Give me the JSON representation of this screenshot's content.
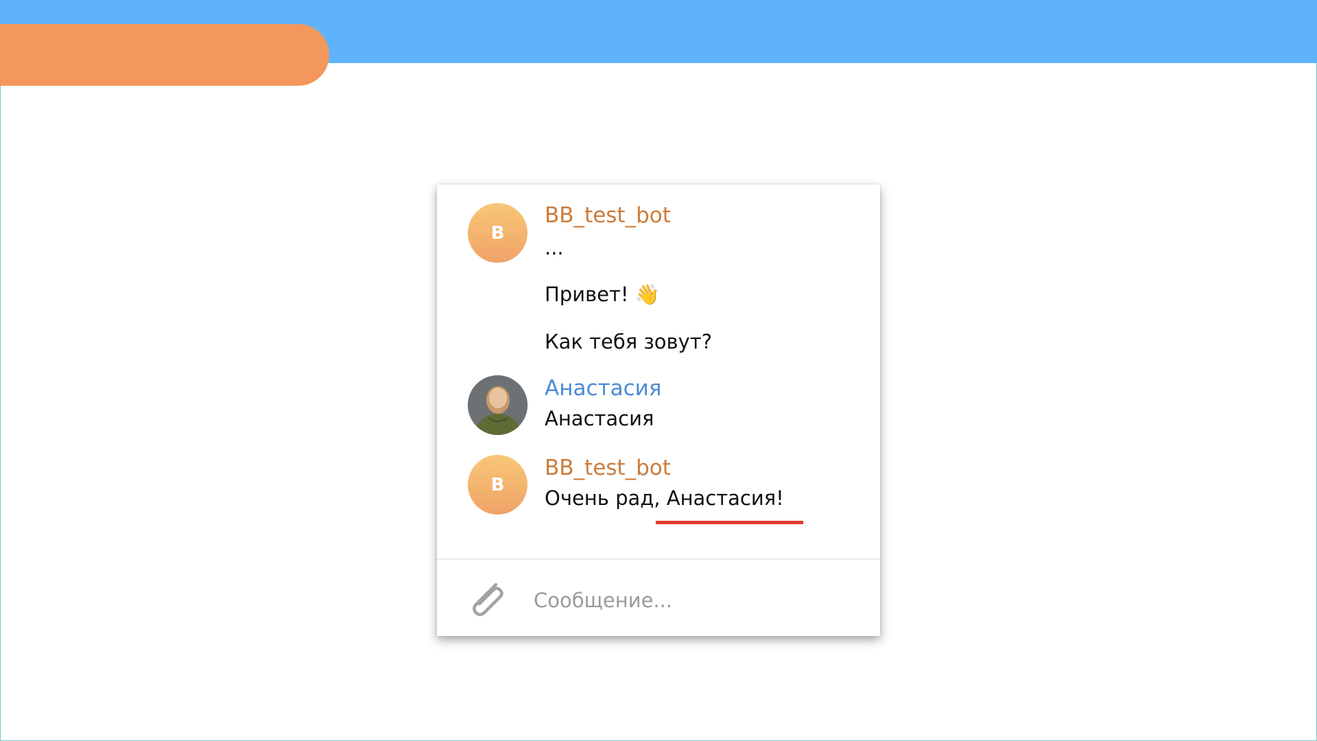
{
  "messages": [
    {
      "sender": "BB_test_bot",
      "avatar_initial": "B",
      "lines": [
        "...",
        "Привет! 👋",
        "Как тебя зовут?"
      ]
    },
    {
      "sender": "Анастасия",
      "lines": [
        "Анастасия"
      ]
    },
    {
      "sender": "BB_test_bot",
      "avatar_initial": "B",
      "lines": [
        "Очень рад, Анастасия!"
      ]
    }
  ],
  "composer": {
    "placeholder": "Сообщение...",
    "attach_icon": "paperclip-icon"
  },
  "colors": {
    "top_bar": "#5fb3fb",
    "orange_pill": "#f3975c",
    "bot_name": "#cd7b3a",
    "user_name": "#4a8ad6",
    "highlight_underline": "#e23b2a"
  }
}
